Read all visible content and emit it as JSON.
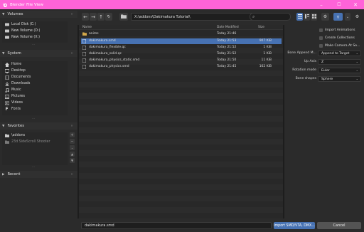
{
  "window": {
    "title": "Blender File View",
    "accent": "#ff63d8"
  },
  "sidebar": {
    "volumes": {
      "heading": "Volumes",
      "items": [
        {
          "label": "Local Disk (C:)",
          "icon": "disk-icon"
        },
        {
          "label": "New Volume (D:)",
          "icon": "disk-icon"
        },
        {
          "label": "New Volume (X:)",
          "icon": "disk-icon"
        }
      ]
    },
    "system": {
      "heading": "System",
      "items": [
        {
          "label": "Home",
          "icon": "home-icon"
        },
        {
          "label": "Desktop",
          "icon": "desktop-icon"
        },
        {
          "label": "Documents",
          "icon": "documents-icon"
        },
        {
          "label": "Downloads",
          "icon": "downloads-icon"
        },
        {
          "label": "Music",
          "icon": "music-icon"
        },
        {
          "label": "Pictures",
          "icon": "pictures-icon"
        },
        {
          "label": "Videos",
          "icon": "videos-icon"
        },
        {
          "label": "Fonts",
          "icon": "fonts-icon"
        }
      ]
    },
    "favorites": {
      "heading": "Favorites",
      "items": [
        {
          "label": "\\addons",
          "icon": "folder-icon"
        },
        {
          "label": "23d SideScroll Shooter",
          "icon": "folder-icon"
        }
      ]
    },
    "recent": {
      "heading": "Recent"
    }
  },
  "toolbar": {
    "path": "X:\\addons\\Dakimakura Tutorial\\",
    "search_placeholder": ""
  },
  "filelist": {
    "columns": {
      "name": "Name",
      "date": "Date Modified",
      "size": "Size"
    },
    "rows": [
      {
        "name": "anims",
        "date": "Today 21:46",
        "size": "",
        "type": "folder"
      },
      {
        "name": "dakimakura.smd",
        "date": "Today 21:53",
        "size": "907 KiB",
        "type": "file",
        "selected": true
      },
      {
        "name": "dakimakura_flexible.qc",
        "date": "Today 21:52",
        "size": "1 KiB",
        "type": "file"
      },
      {
        "name": "dakimakura_solid.qc",
        "date": "Today 21:52",
        "size": "1 KiB",
        "type": "file"
      },
      {
        "name": "dakimakura_physics_static.smd",
        "date": "Today 21:50",
        "size": "11 KiB",
        "type": "file"
      },
      {
        "name": "dakimakura_physics.smd",
        "date": "Today 21:45",
        "size": "162 KiB",
        "type": "file"
      }
    ]
  },
  "options": {
    "import_animations": "Import Animations",
    "create_collections": "Create Collections",
    "make_camera": "Make Camera At So...",
    "bone_append_label": "Bone Append M...",
    "bone_append_value": "Append to Target",
    "up_axis_label": "Up Axis",
    "up_axis_value": "Z",
    "rotation_label": "Rotation mode",
    "rotation_value": "Euler",
    "bone_shapes_label": "Bone shapes",
    "bone_shapes_value": "Sphere"
  },
  "bottom": {
    "filename": "dakimakura.smd",
    "import_label": "Import SMD/VTA, DMX...",
    "cancel_label": "Cancel"
  },
  "colors": {
    "selection": "#4772b3",
    "background": "#1d1d1d",
    "panel": "#2b2b2b"
  }
}
